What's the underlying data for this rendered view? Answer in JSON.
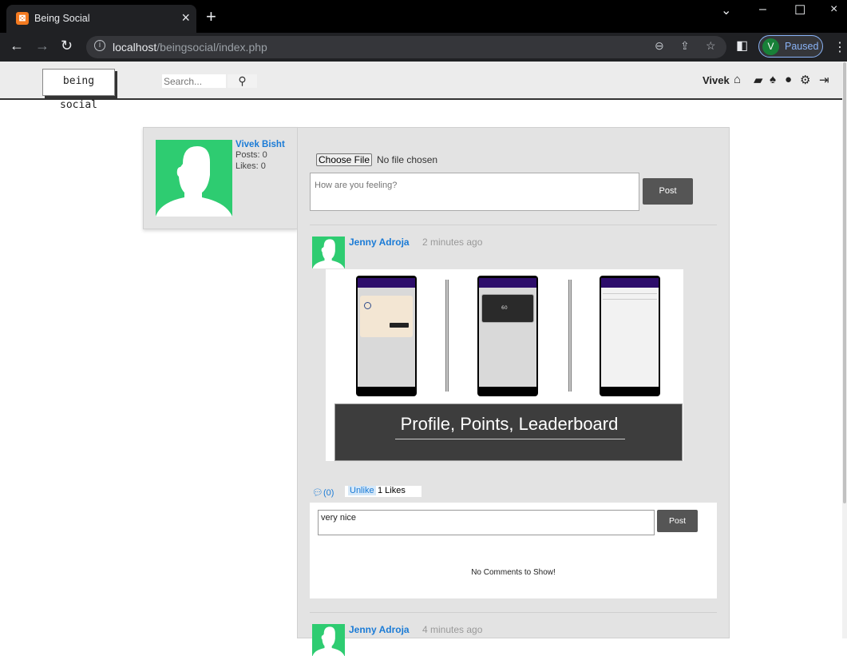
{
  "browser": {
    "tab_title": "Being Social",
    "url_host": "localhost",
    "url_path": "/beingsocial/index.php",
    "profile_initial": "V",
    "profile_status": "Paused"
  },
  "header": {
    "logo_text": "being social",
    "search_placeholder": "Search...",
    "username": "Vivek"
  },
  "profile": {
    "name": "Vivek Bisht",
    "posts": "Posts: 0",
    "likes": "Likes: 0"
  },
  "composer": {
    "choose_file_label": "Choose File",
    "no_file_text": "No file chosen",
    "status_placeholder": "How are you feeling?",
    "post_label": "Post"
  },
  "posts": [
    {
      "author": "Jenny Adroja",
      "time": "2 minutes ago",
      "image_caption": "Profile, Points, Leaderboard",
      "comment_count": "(0)",
      "unlike_label": "Unlike",
      "likes_text": "1 Likes",
      "comment_value": "very nice",
      "comment_post_label": "Post",
      "no_comments_text": "No Comments to Show!"
    },
    {
      "author": "Jenny Adroja",
      "time": "4 minutes ago"
    }
  ],
  "colors": {
    "accent_link": "#1a7bd6",
    "avatar_green": "#2ecc71",
    "button_dark": "#555555"
  }
}
